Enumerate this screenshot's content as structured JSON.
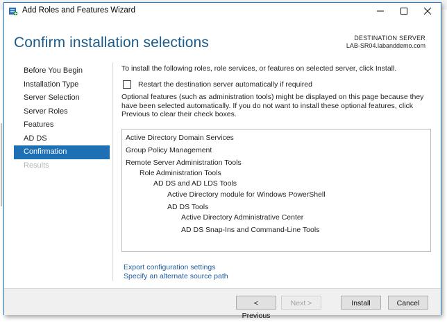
{
  "window": {
    "title": "Add Roles and Features Wizard"
  },
  "header": {
    "page_title": "Confirm installation selections",
    "destination_label": "DESTINATION SERVER",
    "destination_server": "LAB-SR04.labanddemo.com"
  },
  "nav": {
    "items": [
      {
        "label": "Before You Begin",
        "state": "normal"
      },
      {
        "label": "Installation Type",
        "state": "normal"
      },
      {
        "label": "Server Selection",
        "state": "normal"
      },
      {
        "label": "Server Roles",
        "state": "normal"
      },
      {
        "label": "Features",
        "state": "normal"
      },
      {
        "label": "AD DS",
        "state": "normal"
      },
      {
        "label": "Confirmation",
        "state": "active"
      },
      {
        "label": "Results",
        "state": "disabled"
      }
    ]
  },
  "content": {
    "intro": "To install the following roles, role services, or features on selected server, click Install.",
    "restart_label": "Restart the destination server automatically if required",
    "restart_checked": false,
    "optional_note": "Optional features (such as administration tools) might be displayed on this page because they have been selected automatically. If you do not want to install these optional features, click Previous to clear their check boxes.",
    "selections": [
      {
        "label": "Active Directory Domain Services",
        "level": 0
      },
      {
        "label": "Group Policy Management",
        "level": 0
      },
      {
        "label": "Remote Server Administration Tools",
        "level": 0
      },
      {
        "label": "Role Administration Tools",
        "level": 1
      },
      {
        "label": "AD DS and AD LDS Tools",
        "level": 2
      },
      {
        "label": "Active Directory module for Windows PowerShell",
        "level": 3
      },
      {
        "label": "AD DS Tools",
        "level": 3
      },
      {
        "label": "Active Directory Administrative Center",
        "level": 4
      },
      {
        "label": "AD DS Snap-Ins and Command-Line Tools",
        "level": 4
      }
    ],
    "links": {
      "export": "Export configuration settings",
      "alternate_source": "Specify an alternate source path"
    }
  },
  "footer": {
    "previous_label": "< Previous",
    "next_label": "Next >",
    "install_label": "Install",
    "cancel_label": "Cancel"
  },
  "colors": {
    "accent": "#1e70b5",
    "title": "#1c5a89",
    "link": "#1c5a9e"
  }
}
